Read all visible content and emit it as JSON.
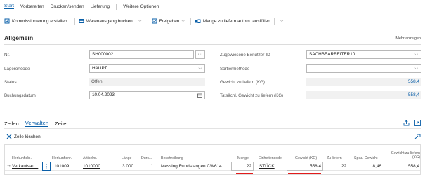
{
  "tabs": [
    "Start",
    "Vorbereiten",
    "Drucken/senden",
    "Lieferung",
    "Weitere Optionen"
  ],
  "actions": {
    "pick": "Kommissionierung erstellen...",
    "post": "Warenausgang buchen...",
    "release": "Freigeben",
    "autofill": "Menge zu liefern autom. ausfüllen"
  },
  "general": {
    "title": "Allgemein",
    "more": "Mehr anzeigen",
    "no_label": "Nr.",
    "no_value": "SH000002",
    "location_label": "Lagerortcode",
    "location_value": "HAUPT",
    "status_label": "Status",
    "status_value": "Offen",
    "posting_label": "Buchungsdatum",
    "posting_value": "10.04.2023",
    "assigned_label": "Zugewiesene Benutzer-ID",
    "assigned_value": "SACHBEARBEITER10",
    "sort_label": "Sortiermethode",
    "sort_value": "",
    "weight_label": "Gewicht zu liefern (KG)",
    "weight_value": "558,4",
    "actual_weight_label": "Tatsächl. Gewicht zu liefern (KG)",
    "actual_weight_value": "558,4"
  },
  "lines": {
    "title": "Zeilen",
    "tab_manage": "Verwalten",
    "tab_line": "Zeile",
    "delete_line": "Zeile löschen",
    "columns": [
      "Herkunftsb...",
      "Herkunftsnr.",
      "Artikelnr.",
      "Länge",
      "Durc...",
      "Beschreibung",
      "Menge",
      "Einheitencode",
      "Gewicht (KG)",
      "Zu liefern",
      "Spez. Gewicht",
      "Gewicht zu liefern (KG)"
    ],
    "row": {
      "source_type": "Verkaufsau...",
      "source_no": "101009",
      "item_no": "1010000",
      "length": "3.000",
      "diameter": "1",
      "description": "Messing Rundstangen CW614...",
      "quantity": "22",
      "unit": "STÜCK",
      "weight": "558,4",
      "to_ship": "22",
      "spec_weight": "8,46",
      "weight_to_ship": "558,4"
    }
  },
  "colors": {
    "accent": "#0a5fa8",
    "highlight": "#e21b1b"
  }
}
